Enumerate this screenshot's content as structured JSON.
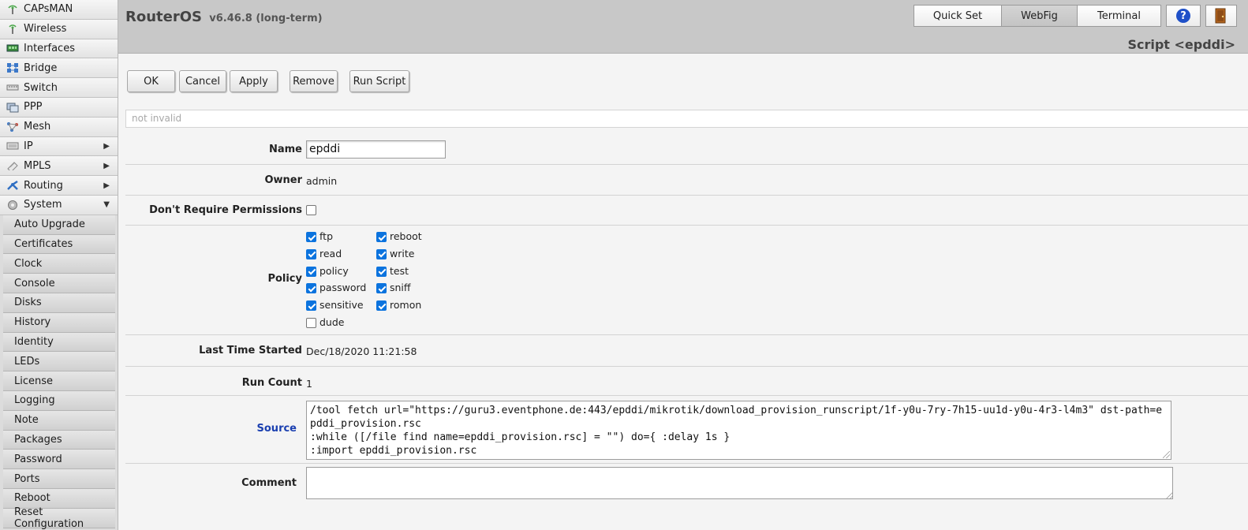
{
  "sidebar": {
    "items": [
      {
        "label": "CAPsMAN",
        "icon": "capsman-icon"
      },
      {
        "label": "Wireless",
        "icon": "wireless-icon"
      },
      {
        "label": "Interfaces",
        "icon": "interfaces-icon"
      },
      {
        "label": "Bridge",
        "icon": "bridge-icon"
      },
      {
        "label": "Switch",
        "icon": "switch-icon"
      },
      {
        "label": "PPP",
        "icon": "ppp-icon"
      },
      {
        "label": "Mesh",
        "icon": "mesh-icon"
      },
      {
        "label": "IP",
        "icon": "ip-icon",
        "arrow": "▶"
      },
      {
        "label": "MPLS",
        "icon": "mpls-icon",
        "arrow": "▶"
      },
      {
        "label": "Routing",
        "icon": "routing-icon",
        "arrow": "▶"
      },
      {
        "label": "System",
        "icon": "system-icon",
        "arrow": "▼"
      }
    ],
    "subitems": [
      "Auto Upgrade",
      "Certificates",
      "Clock",
      "Console",
      "Disks",
      "History",
      "Identity",
      "LEDs",
      "License",
      "Logging",
      "Note",
      "Packages",
      "Password",
      "Ports",
      "Reboot",
      "Reset Configuration"
    ]
  },
  "header": {
    "brand": "RouterOS",
    "version": "v6.46.8 (long-term)",
    "quickset": "Quick Set",
    "webfig": "WebFig",
    "terminal": "Terminal",
    "help_icon": "?",
    "page_title": "Script <epddi>"
  },
  "actions": {
    "ok": "OK",
    "cancel": "Cancel",
    "apply": "Apply",
    "remove": "Remove",
    "run_script": "Run Script"
  },
  "status": "not invalid",
  "form": {
    "name_label": "Name",
    "name_value": "epddi",
    "owner_label": "Owner",
    "owner_value": "admin",
    "dontreq_label": "Don't Require Permissions",
    "dontreq_checked": false,
    "policy_label": "Policy",
    "policies": [
      {
        "label": "ftp",
        "checked": true
      },
      {
        "label": "reboot",
        "checked": true
      },
      {
        "label": "read",
        "checked": true
      },
      {
        "label": "write",
        "checked": true
      },
      {
        "label": "policy",
        "checked": true
      },
      {
        "label": "test",
        "checked": true
      },
      {
        "label": "password",
        "checked": true
      },
      {
        "label": "sniff",
        "checked": true
      },
      {
        "label": "sensitive",
        "checked": true
      },
      {
        "label": "romon",
        "checked": true
      },
      {
        "label": "dude",
        "checked": false
      }
    ],
    "last_started_label": "Last Time Started",
    "last_started_value": "Dec/18/2020 11:21:58",
    "run_count_label": "Run Count",
    "run_count_value": "1",
    "source_label": "Source",
    "source_lines": [
      "/tool fetch url=\"https://guru3.eventphone.de:443/epddi/mikrotik/download_provision_runscript/1f-y0u-7ry-7h15-uu1d-y0u-4r3-l4m3\" dst-path=epddi_provision.rsc",
      ":while ([/file find name=epddi_provision.rsc] = \"\") do={ :delay 1s }",
      ":import epddi_provision.rsc"
    ],
    "comment_label": "Comment",
    "comment_value": ""
  },
  "colors": {
    "header_bg": "#c8c8c8",
    "source_label": "#1a3fb0",
    "checkbox": "#0b73de"
  }
}
